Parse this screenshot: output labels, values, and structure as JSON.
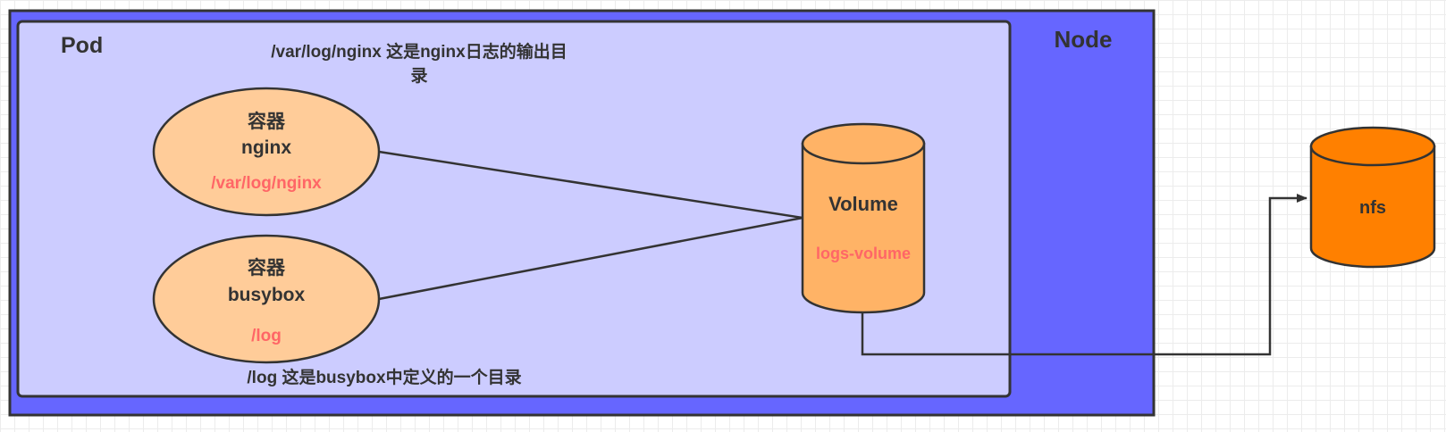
{
  "node": {
    "label": "Node",
    "fill_color": "#6666ff"
  },
  "pod": {
    "label": "Pod",
    "fill_color": "#ccccff",
    "annotation_top_line1": "/var/log/nginx 这是nginx日志的输出目",
    "annotation_top_line2": "录",
    "annotation_bottom": "/log 这是busybox中定义的一个目录"
  },
  "containers": [
    {
      "title": "容器",
      "name": "nginx",
      "mount_path": "/var/log/nginx"
    },
    {
      "title": "容器",
      "name": "busybox",
      "mount_path": "/log"
    }
  ],
  "volume": {
    "label": "Volume",
    "name": "logs-volume",
    "fill_color": "#ffb366"
  },
  "nfs": {
    "label": "nfs",
    "fill_color": "#ff8000"
  },
  "colors": {
    "container_fill": "#ffcc99",
    "mount_text": "#ff6666",
    "stroke": "#333333"
  }
}
